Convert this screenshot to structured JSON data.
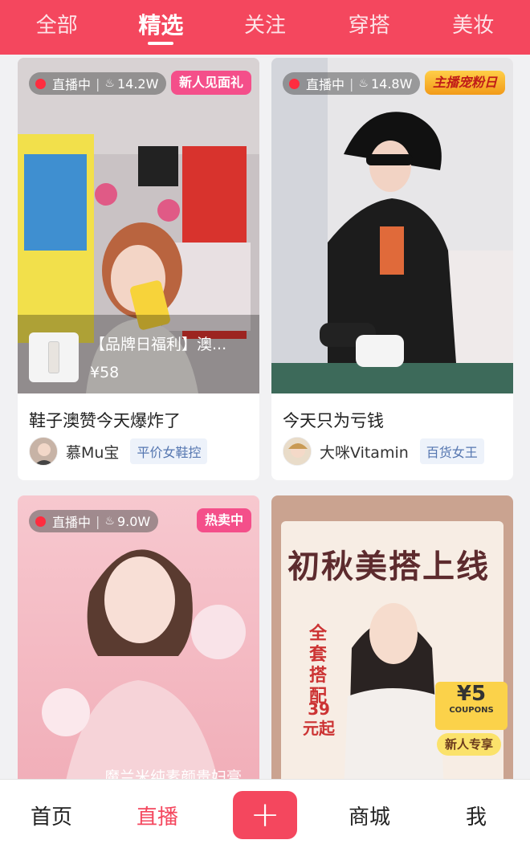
{
  "top_tabs": [
    {
      "label": "全部",
      "active": false
    },
    {
      "label": "精选",
      "active": true
    },
    {
      "label": "关注",
      "active": false
    },
    {
      "label": "穿搭",
      "active": false
    },
    {
      "label": "美妆",
      "active": false
    }
  ],
  "cards": [
    {
      "status": "直播中",
      "viewers": "14.2W",
      "badge": "新人见面礼",
      "product_name": "【品牌日福利】澳...",
      "product_price": "¥58",
      "title": "鞋子澳赞今天爆炸了",
      "author": "慕Mu宝",
      "tag": "平价女鞋控"
    },
    {
      "status": "直播中",
      "viewers": "14.8W",
      "badge": "主播宠粉日",
      "title": "今天只为亏钱",
      "author": "大咪Vitamin",
      "tag": "百货女王"
    },
    {
      "status": "直播中",
      "viewers": "9.0W",
      "badge": "热卖中",
      "caption": "魔兰米纯素颜贵妇膏"
    },
    {
      "poster_headline": "初秋美搭上线",
      "poster_sub": "全套搭配",
      "poster_price": "39元起",
      "coupon_value": "¥5",
      "coupon_label": "COUPONS",
      "coupon_badge": "新人专享"
    }
  ],
  "bottom_nav": {
    "home": "首页",
    "live": "直播",
    "plus": "+",
    "mall": "商城",
    "me": "我"
  },
  "colors": {
    "accent": "#f4475e",
    "live_dot": "#ff2d3f",
    "tag_text": "#5576b0"
  }
}
